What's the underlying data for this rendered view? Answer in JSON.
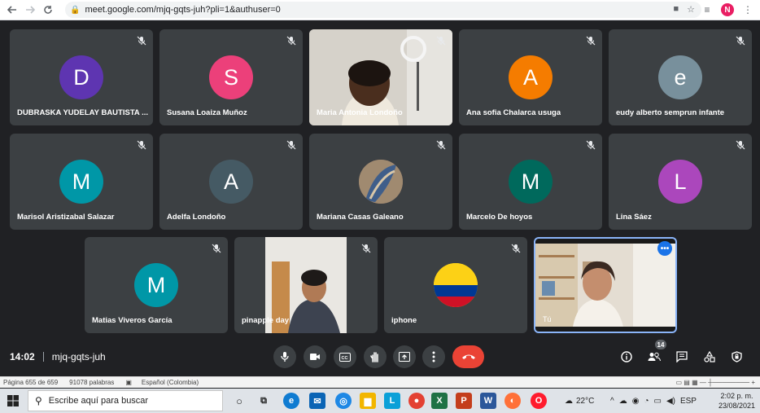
{
  "browser": {
    "url_domain": "meet.google.com",
    "url_path": "/mjq-gqts-juh?pli=1&authuser=0",
    "profile_initial": "N"
  },
  "tiles_row1": [
    {
      "initial": "D",
      "name": "DUBRASKA YUDELAY BAUTISTA ...",
      "color": "#5e35b1"
    },
    {
      "initial": "S",
      "name": "Susana Loaiza Muñoz",
      "color": "#ec407a"
    },
    {
      "initial": "",
      "name": "Maria Antonia Londoño",
      "color": "#6b6b6b"
    },
    {
      "initial": "A",
      "name": "Ana sofia Chalarca usuga",
      "color": "#f57c00"
    },
    {
      "initial": "e",
      "name": "eudy alberto semprun infante",
      "color": "#78909c"
    }
  ],
  "tiles_row2": [
    {
      "initial": "M",
      "name": "Marisol Aristizabal Salazar",
      "color": "#0097a7"
    },
    {
      "initial": "A",
      "name": "Adelfa Londoño",
      "color": "#455a64"
    },
    {
      "initial": "",
      "name": "Mariana Casas Galeano",
      "color": "#8d6e63"
    },
    {
      "initial": "M",
      "name": "Marcelo De hoyos",
      "color": "#00695c"
    },
    {
      "initial": "L",
      "name": "Lina Sáez",
      "color": "#ab47bc"
    }
  ],
  "tiles_row3": [
    {
      "initial": "M",
      "name": "Matias Viveros García",
      "color": "#0097a7"
    },
    {
      "initial": "",
      "name": "pinapple day",
      "color": "#000000"
    },
    {
      "initial": "",
      "name": "iphone",
      "color": "#3c4043"
    },
    {
      "initial": "",
      "name": "Tú",
      "color": "#000000"
    }
  ],
  "meeting": {
    "time": "14:02",
    "code": "mjq-gqts-juh",
    "participants_count": "14"
  },
  "word_status": {
    "page": "Página 655 de 659",
    "words": "91078 palabras",
    "language": "Español (Colombia)"
  },
  "taskbar": {
    "search_placeholder": "Escribe aquí para buscar",
    "weather": "22°C",
    "lang": "ESP",
    "time": "2:02 p. m.",
    "date": "23/08/2021"
  },
  "colors": {
    "meet_bg": "#202124",
    "tile_bg": "#3c4043",
    "end_call": "#ea4335",
    "active_speaker": "#8ab4f8"
  }
}
